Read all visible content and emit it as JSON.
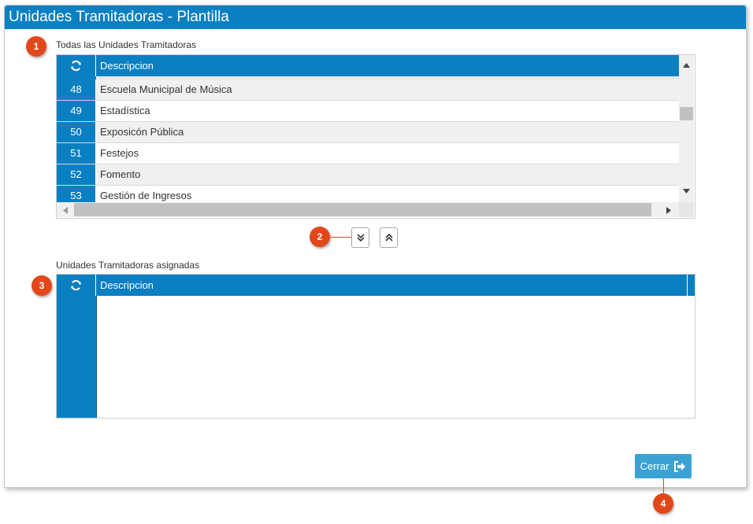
{
  "window": {
    "title": "Unidades Tramitadoras - Plantilla"
  },
  "available": {
    "label": "Todas las Unidades Tramitadoras",
    "header_description": "Descripcion",
    "rows": [
      {
        "id": "48",
        "description": "Escuela Municipal de Música"
      },
      {
        "id": "49",
        "description": "Estadística"
      },
      {
        "id": "50",
        "description": "Exposicón Pública"
      },
      {
        "id": "51",
        "description": "Festejos"
      },
      {
        "id": "52",
        "description": "Fomento"
      },
      {
        "id": "53",
        "description": "Gestión de Ingresos"
      }
    ]
  },
  "assigned": {
    "label": "Unidades Tramitadoras asignadas",
    "header_description": "Descripcion",
    "rows": []
  },
  "actions": {
    "close_label": "Cerrar"
  },
  "callouts": [
    "1",
    "2",
    "3",
    "4"
  ],
  "icons": {
    "refresh": "refresh-icon",
    "move_down": "double-chevron-down-icon",
    "move_up": "double-chevron-up-icon",
    "close": "sign-out-icon"
  },
  "colors": {
    "accent": "#0a7fc2",
    "callout": "#e2471b",
    "close_button": "#3aa3d4"
  }
}
